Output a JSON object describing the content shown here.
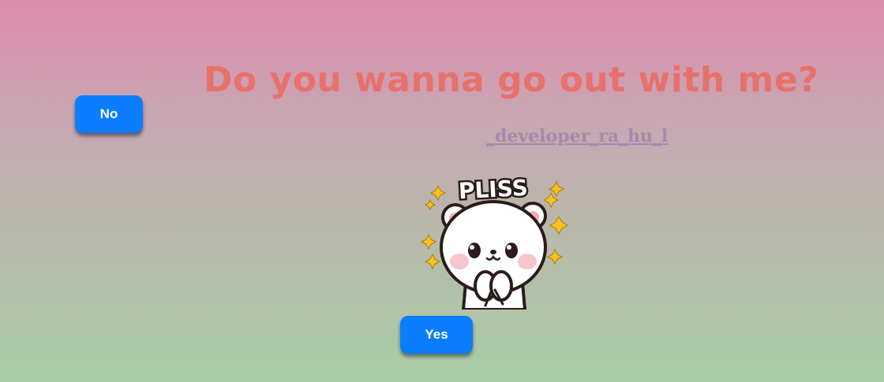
{
  "headline": "Do you wanna go out with me?",
  "credit": "_developer_ra_hu_l",
  "sticker": {
    "text": "PLISS",
    "icon": "bear-pleading-sticker"
  },
  "buttons": {
    "no_label": "No",
    "yes_label": "Yes"
  },
  "colors": {
    "headline": "#e8716b",
    "credit": "#a889ad",
    "button": "#0b7dff",
    "background_top": "#de8dac",
    "background_bottom": "#a7cea6"
  }
}
